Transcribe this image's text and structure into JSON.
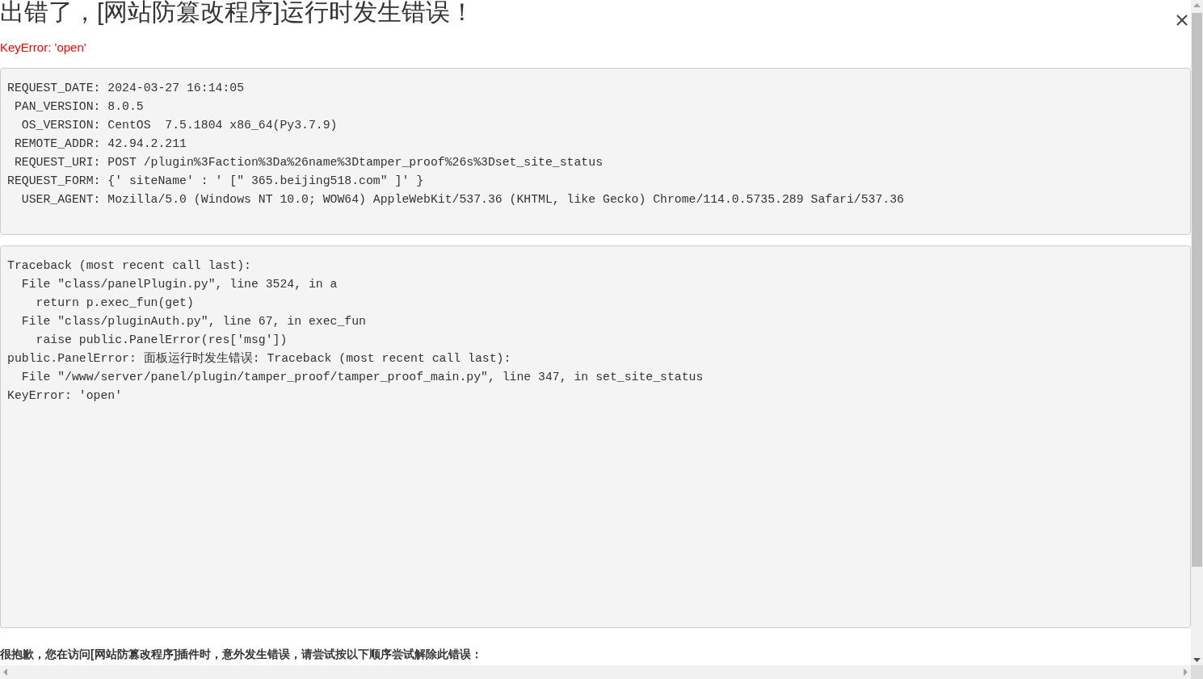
{
  "title": "出错了，[网站防篡改程序]运行时发生错误！",
  "error_summary": "KeyError: 'open'",
  "request_info": [
    "REQUEST_DATE: 2024-03-27 16:14:05",
    " PAN_VERSION: 8.0.5",
    "  OS_VERSION: CentOS  7.5.1804 x86_64(Py3.7.9)",
    " REMOTE_ADDR: 42.94.2.211",
    " REQUEST_URI: POST /plugin%3Faction%3Da%26name%3Dtamper_proof%26s%3Dset_site_status",
    "REQUEST_FORM: {' siteName' : ' [\" 365.beijing518.com\" ]' }",
    "  USER_AGENT: Mozilla/5.0 (Windows NT 10.0; WOW64) AppleWebKit/537.36 (KHTML, like Gecko) Chrome/114.0.5735.289 Safari/537.36"
  ],
  "traceback": [
    "Traceback (most recent call last):",
    "  File \"class/panelPlugin.py\", line 3524, in a",
    "    return p.exec_fun(get)",
    "  File \"class/pluginAuth.py\", line 67, in exec_fun",
    "    raise public.PanelError(res['msg'])",
    "public.PanelError: 面板运行时发生错误: Traceback (most recent call last):",
    "  File \"/www/server/panel/plugin/tamper_proof/tamper_proof_main.py\", line 347, in set_site_status",
    "KeyError: 'open'"
  ],
  "apology": "很抱歉，您在访问[网站防篡改程序]插件时，意外发生错误，请尝试按以下顺序尝试解除此错误："
}
